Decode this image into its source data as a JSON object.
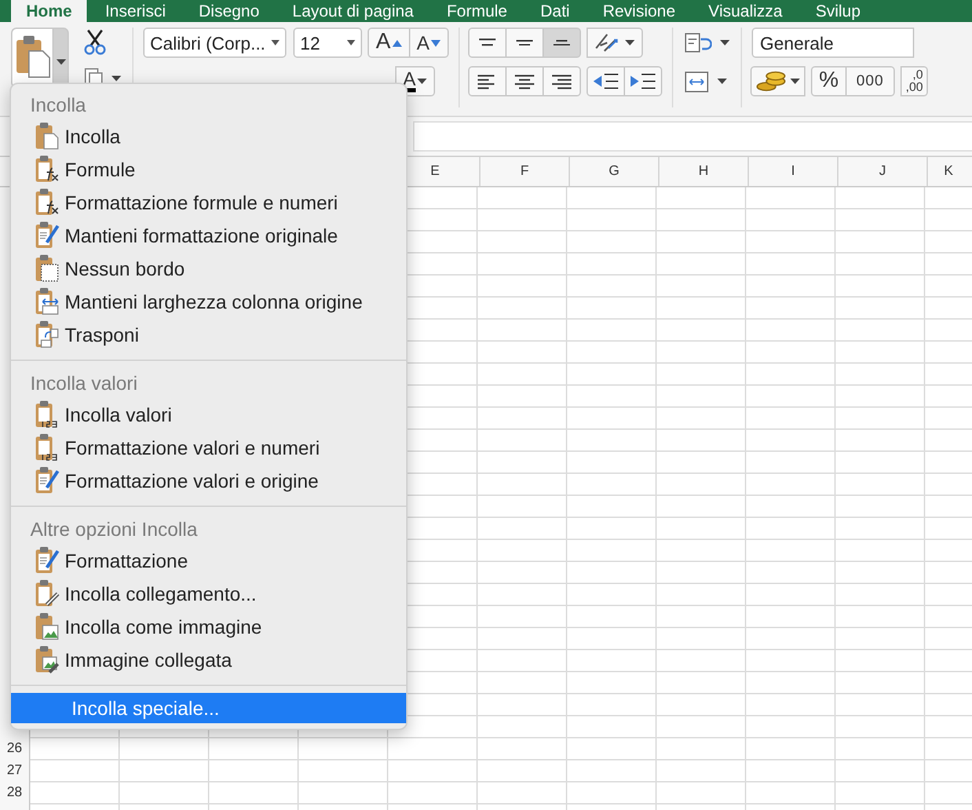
{
  "ribbon_tabs": [
    {
      "label": "Home",
      "selected": true
    },
    {
      "label": "Inserisci",
      "selected": false
    },
    {
      "label": "Disegno",
      "selected": false
    },
    {
      "label": "Layout di pagina",
      "selected": false
    },
    {
      "label": "Formule",
      "selected": false
    },
    {
      "label": "Dati",
      "selected": false
    },
    {
      "label": "Revisione",
      "selected": false
    },
    {
      "label": "Visualizza",
      "selected": false
    },
    {
      "label": "Svilup",
      "selected": false
    }
  ],
  "font": {
    "family": "Calibri (Corp...",
    "size": "12",
    "grow_label": "A",
    "shrink_label": "A",
    "color_label": "A"
  },
  "alignment": {
    "vertical": [
      {
        "kind": "top",
        "selected": false
      },
      {
        "kind": "middle",
        "selected": false
      },
      {
        "kind": "bottom",
        "selected": true
      }
    ],
    "horizontal": [
      {
        "kind": "left",
        "selected": false
      },
      {
        "kind": "center",
        "selected": false
      },
      {
        "kind": "right",
        "selected": false
      }
    ]
  },
  "number": {
    "format": "Generale",
    "percent": "%",
    "thousands": "000",
    "decimal_top": ",0",
    "decimal_bottom": ",00"
  },
  "columns": [
    "E",
    "F",
    "G",
    "H",
    "I",
    "J",
    "K"
  ],
  "row_numbers": [
    "26",
    "27",
    "28"
  ],
  "paste_menu": {
    "sections": [
      {
        "heading": "Incolla",
        "items": [
          {
            "label": "Incolla",
            "kind": "paste",
            "selected": false
          },
          {
            "label": "Formule",
            "kind": "formulas",
            "selected": false
          },
          {
            "label": "Formattazione formule e numeri",
            "kind": "formulas-numbers",
            "selected": false
          },
          {
            "label": "Mantieni formattazione originale",
            "kind": "brush",
            "selected": false
          },
          {
            "label": "Nessun bordo",
            "kind": "no-borders",
            "selected": false
          },
          {
            "label": "Mantieni larghezza colonna origine",
            "kind": "widths",
            "selected": false
          },
          {
            "label": "Trasponi",
            "kind": "transpose",
            "selected": false
          }
        ]
      },
      {
        "heading": "Incolla valori",
        "items": [
          {
            "label": "Incolla valori",
            "kind": "values",
            "selected": false
          },
          {
            "label": "Formattazione valori e numeri",
            "kind": "values-numbers",
            "selected": false
          },
          {
            "label": "Formattazione valori e origine",
            "kind": "values-brush",
            "selected": false
          }
        ]
      },
      {
        "heading": "Altre opzioni Incolla",
        "items": [
          {
            "label": "Formattazione",
            "kind": "brush",
            "selected": false
          },
          {
            "label": "Incolla collegamento...",
            "kind": "link",
            "selected": false
          },
          {
            "label": "Incolla come immagine",
            "kind": "picture",
            "selected": false
          },
          {
            "label": "Immagine collegata",
            "kind": "picture-link",
            "selected": false
          }
        ]
      }
    ],
    "footer": {
      "label": "Incolla speciale...",
      "selected": true
    }
  }
}
